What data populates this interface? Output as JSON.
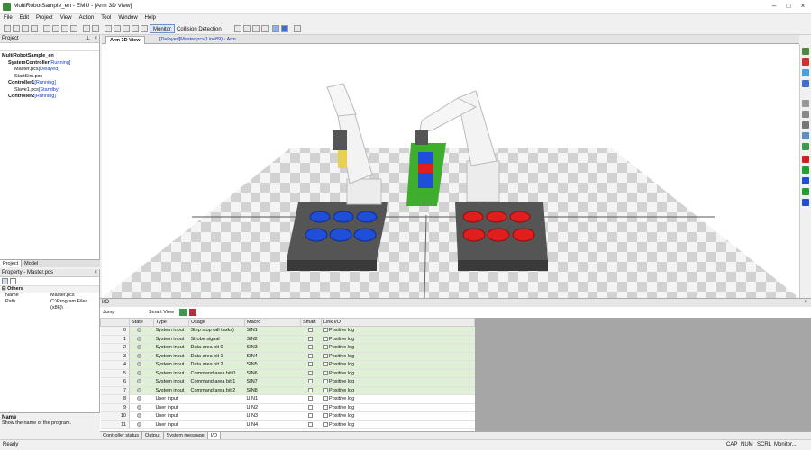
{
  "window": {
    "title": "MultiRobotSample_en - EMU - [Arm 3D View]"
  },
  "menu": [
    "File",
    "Edit",
    "Project",
    "View",
    "Action",
    "Tool",
    "Window",
    "Help"
  ],
  "toolbar": {
    "monitor_label": "Monitor",
    "collision_label": "Collision Detection"
  },
  "project_panel": {
    "title": "Project",
    "tree": [
      {
        "label": "MultiRobotSample_en",
        "status": "",
        "bold": true,
        "indent": 0
      },
      {
        "label": "SystemController",
        "status": "[Running]",
        "bold": true,
        "indent": 1
      },
      {
        "label": "Master.pcs",
        "status": "[Delayed]",
        "bold": false,
        "indent": 2
      },
      {
        "label": "StartSim.pcs",
        "status": "",
        "bold": false,
        "indent": 2
      },
      {
        "label": "Controller1",
        "status": "[Running]",
        "bold": true,
        "indent": 1
      },
      {
        "label": "Slave1.pcs",
        "status": "[Standby]",
        "bold": false,
        "indent": 2
      },
      {
        "label": "Controller2",
        "status": "[Running]",
        "bold": true,
        "indent": 1
      }
    ],
    "tabs": [
      "Project",
      "Model"
    ]
  },
  "property_panel": {
    "title": "Property - Master.pcs",
    "section": "Others",
    "rows": [
      {
        "key": "Name",
        "value": "Master.pcs"
      },
      {
        "key": "Path",
        "value": "C:\\Program Files (x86)\\"
      }
    ],
    "desc_title": "Name",
    "desc_text": "Show the name of the program."
  },
  "view_tabs": [
    "Arm 3D View",
    "[Delayed]Master.pcs(Line89) - Arm..."
  ],
  "io_panel": {
    "title": "I/O",
    "jump_label": "Jump",
    "smartview_label": "Smart View",
    "columns": [
      "State",
      "Type",
      "Usage",
      "Macro",
      "Smart",
      "Link I/O"
    ],
    "rows": [
      {
        "num": "0",
        "type": "System input",
        "usage": "Step stop (all tasks)",
        "macro": "SIN1",
        "link": "Positive log",
        "sys": true
      },
      {
        "num": "1",
        "type": "System input",
        "usage": "Strobe signal",
        "macro": "SIN2",
        "link": "Positive log",
        "sys": true
      },
      {
        "num": "2",
        "type": "System input",
        "usage": "Data area bit 0",
        "macro": "SIN3",
        "link": "Positive log",
        "sys": true
      },
      {
        "num": "3",
        "type": "System input",
        "usage": "Data area bit 1",
        "macro": "SIN4",
        "link": "Positive log",
        "sys": true
      },
      {
        "num": "4",
        "type": "System input",
        "usage": "Data area bit 2",
        "macro": "SIN5",
        "link": "Positive log",
        "sys": true
      },
      {
        "num": "5",
        "type": "System input",
        "usage": "Command area  bit 0",
        "macro": "SIN6",
        "link": "Positive log",
        "sys": true
      },
      {
        "num": "6",
        "type": "System input",
        "usage": "Command area  bit 1",
        "macro": "SIN7",
        "link": "Positive log",
        "sys": true
      },
      {
        "num": "7",
        "type": "System input",
        "usage": "Command area  bit 2",
        "macro": "SIN8",
        "link": "Positive log",
        "sys": true
      },
      {
        "num": "8",
        "type": "User input",
        "usage": "",
        "macro": "UIN1",
        "link": "Positive log",
        "sys": false
      },
      {
        "num": "9",
        "type": "User input",
        "usage": "",
        "macro": "UIN2",
        "link": "Positive log",
        "sys": false
      },
      {
        "num": "10",
        "type": "User input",
        "usage": "",
        "macro": "UIN3",
        "link": "Positive log",
        "sys": false
      },
      {
        "num": "11",
        "type": "User input",
        "usage": "",
        "macro": "UIN4",
        "link": "Positive log",
        "sys": false
      }
    ],
    "bottom_tabs": [
      "Controller status",
      "Output",
      "System message",
      "I/O"
    ]
  },
  "status": {
    "left": "Ready",
    "indicators": [
      "CAP",
      "NUM",
      "SCRL",
      "Monitor..."
    ]
  },
  "colors": {
    "accent": "#1a3fbf",
    "sys_row": "#dff0d6",
    "blue_part": "#1f4fd8",
    "red_part": "#e01e1e",
    "conveyor": "#3fae2e"
  }
}
